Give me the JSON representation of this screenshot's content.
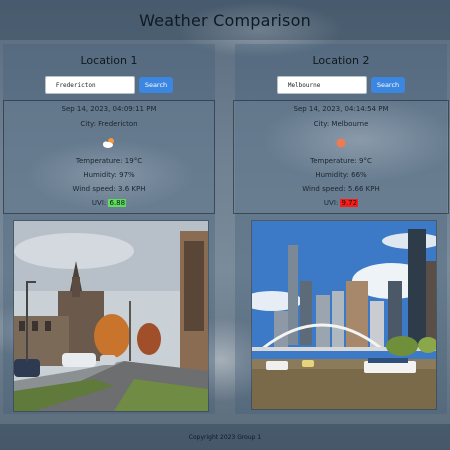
{
  "header": {
    "title": "Weather Comparison"
  },
  "locations": [
    {
      "title": "Location 1",
      "search": {
        "value": "Fredericton",
        "button_label": "Search"
      },
      "datetime": "Sep 14, 2023, 04:09:11 PM",
      "city_line": "City: Fredericton",
      "icon": "partly-cloudy-icon",
      "temperature": "Temperature: 19°C",
      "humidity": "Humidity: 97%",
      "wind": "Wind speed: 3.6 KPH",
      "uv_label": "UVI:",
      "uv_value": "6.88",
      "uv_color": "#5fdc5f",
      "photo": "fredericton-street-photo"
    },
    {
      "title": "Location 2",
      "search": {
        "value": "Melbourne",
        "button_label": "Search"
      },
      "datetime": "Sep 14, 2023, 04:14:54 PM",
      "city_line": "City: Melbourne",
      "icon": "sun-icon",
      "temperature": "Temperature: 9°C",
      "humidity": "Humidity: 66%",
      "wind": "Wind speed: 5.66 KPH",
      "uv_label": "UVI:",
      "uv_value": "9.72",
      "uv_color": "#ff1a1a",
      "photo": "melbourne-skyline-photo"
    }
  ],
  "footer": {
    "text": "Copyright 2023 Group 1"
  }
}
